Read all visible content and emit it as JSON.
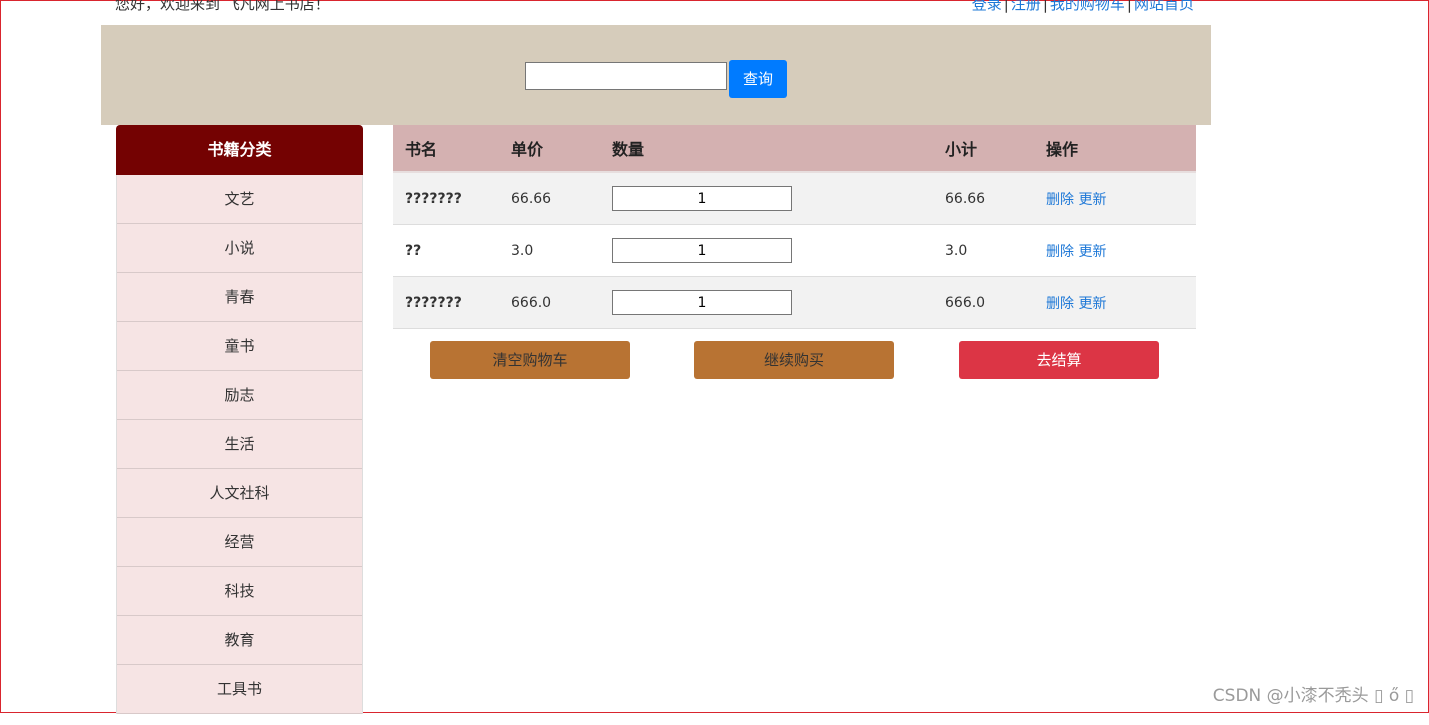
{
  "header": {
    "greeting": "您好，欢迎来到 飞凡网上书店！",
    "links": [
      "登录",
      "注册",
      "我的购物车",
      "网站首页"
    ],
    "separator": "|"
  },
  "search": {
    "value": "",
    "placeholder": "",
    "button_label": "查询"
  },
  "sidebar": {
    "title": "书籍分类",
    "items": [
      "文艺",
      "小说",
      "青春",
      "童书",
      "励志",
      "生活",
      "人文社科",
      "经营",
      "科技",
      "教育",
      "工具书"
    ]
  },
  "cart": {
    "columns": [
      "书名",
      "单价",
      "数量",
      "小计",
      "操作"
    ],
    "rows": [
      {
        "name": "???????",
        "price": "66.66",
        "qty": "1",
        "subtotal": "66.66"
      },
      {
        "name": "??",
        "price": "3.0",
        "qty": "1",
        "subtotal": "3.0"
      },
      {
        "name": "???????",
        "price": "666.0",
        "qty": "1",
        "subtotal": "666.0"
      }
    ],
    "delete_label": "删除",
    "update_label": "更新"
  },
  "actions": {
    "clear_label": "清空购物车",
    "continue_label": "继续购买",
    "checkout_label": "去结算"
  },
  "watermark": "CSDN @小漆不秃头 ▯ ő ▯",
  "colors": {
    "banner": "#d6ccbb",
    "sidebar_title": "#740202",
    "sidebar_bg": "#f6e4e4",
    "table_header": "#d4b1b1",
    "search_button": "#007bff",
    "action_button": "#b87333",
    "checkout_button": "#dc3545",
    "link": "#1e78d7"
  }
}
